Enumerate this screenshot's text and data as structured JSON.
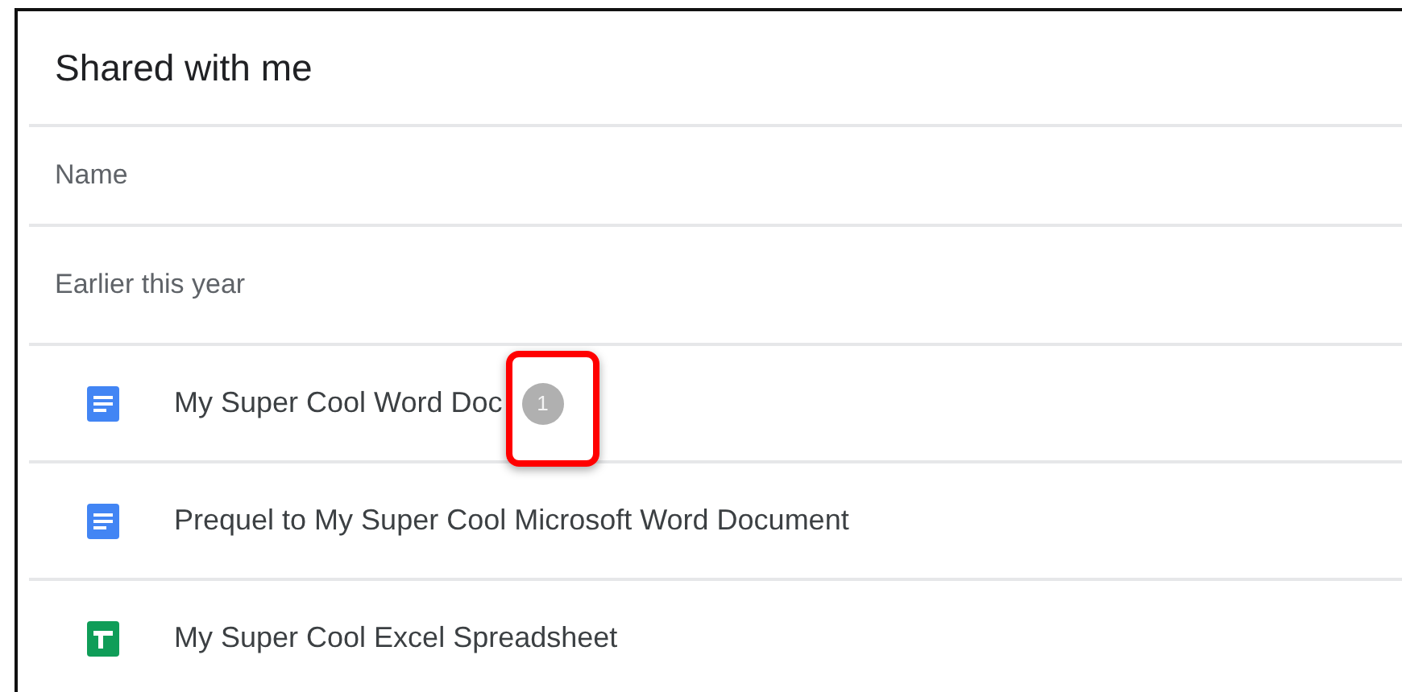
{
  "title": "Shared with me",
  "column_header": "Name",
  "section": "Earlier this year",
  "files": [
    {
      "kind": "doc",
      "name": "My Super Cool Word Doc",
      "badge": "1",
      "highlighted": true
    },
    {
      "kind": "doc",
      "name": "Prequel to My Super Cool Microsoft Word Document"
    },
    {
      "kind": "sheet",
      "name": "My Super Cool Excel Spreadsheet"
    }
  ]
}
